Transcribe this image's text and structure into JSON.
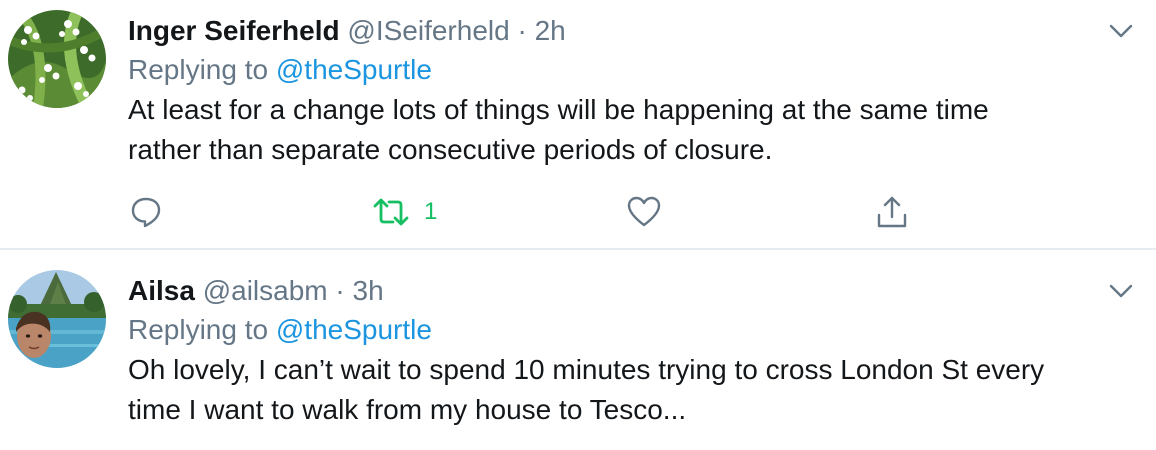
{
  "tweets": [
    {
      "name": "Inger Seiferheld",
      "handle": "@ISeiferheld",
      "separator": "·",
      "time": "2h",
      "replying_prefix": "Replying to ",
      "replying_to": "@theSpurtle",
      "text": "At least for a change lots of things will be happening at the same time\nrather than separate consecutive periods of closure.",
      "retweet_count": "1",
      "avatar_icon": "lily-of-the-valley-avatar"
    },
    {
      "name": "Ailsa",
      "handle": "@ailsabm",
      "separator": "·",
      "time": "3h",
      "replying_prefix": "Replying to ",
      "replying_to": "@theSpurtle",
      "text": "Oh lovely, I can’t wait to spend 10 minutes trying to cross London St every\ntime I want to walk from my house to Tesco...",
      "avatar_icon": "tropical-pool-selfie-avatar"
    }
  ],
  "colors": {
    "name": "#14171a",
    "muted": "#657786",
    "link": "#1b95e0",
    "retweet_active": "#17bf63",
    "divider": "#e6ecf0"
  },
  "icons": {
    "reply": "reply-icon",
    "retweet": "retweet-icon",
    "like": "heart-icon",
    "share": "share-icon",
    "menu": "chevron-down-icon"
  }
}
